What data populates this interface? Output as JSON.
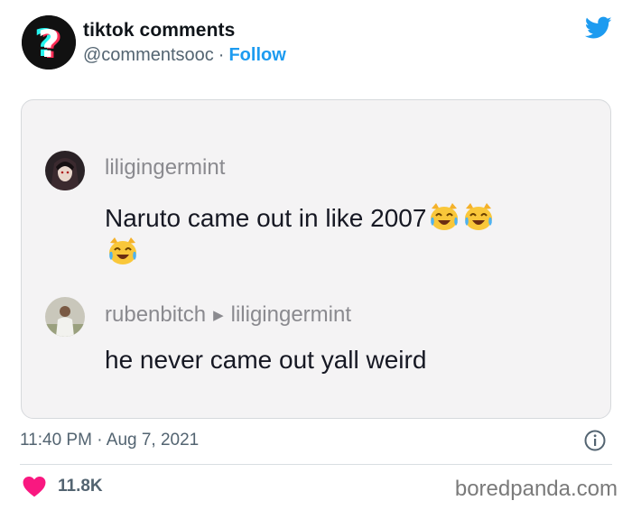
{
  "header": {
    "display_name": "tiktok comments",
    "handle": "@commentsooc",
    "separator": "·",
    "follow_label": "Follow"
  },
  "icons": {
    "brand": "twitter-bird-icon",
    "avatar": "tiktok-question-mark-icon",
    "info": "info-icon",
    "like": "heart-icon"
  },
  "comments": [
    {
      "username": "liligingermint",
      "text": "Naruto came out in like 2007",
      "emoji": "crying-laughing-cat"
    },
    {
      "username": "rubenbitch",
      "reply_to": "liligingermint",
      "text": "he never came out yall weird"
    }
  ],
  "footer": {
    "time": "11:40 PM",
    "date_separator": "·",
    "date": "Aug 7, 2021",
    "likes": "11.8K"
  },
  "watermark": "boredpanda.com",
  "colors": {
    "twitter_blue": "#1d9bf0",
    "heart": "#f91880",
    "muted": "#536471"
  }
}
